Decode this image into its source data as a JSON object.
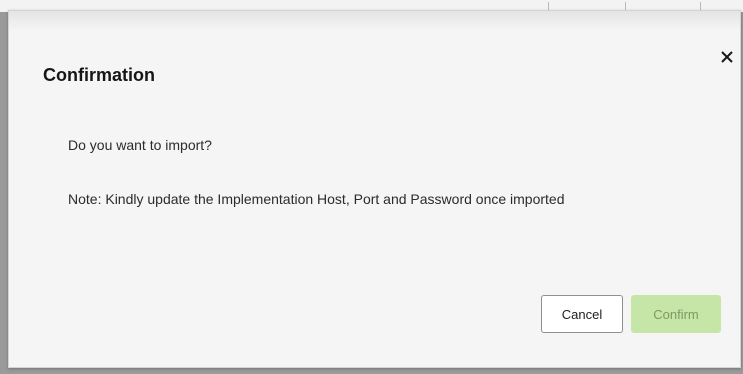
{
  "dialog": {
    "title": "Confirmation",
    "message": "Do you want to import?",
    "note": "Note: Kindly update the Implementation Host, Port and Password once imported",
    "close_icon": "close-icon",
    "buttons": {
      "cancel_label": "Cancel",
      "confirm_label": "Confirm"
    }
  },
  "colors": {
    "confirm_button_bg": "#c6e6a8",
    "confirm_button_text": "#7c9a5e",
    "dialog_bg": "#f5f5f5",
    "overlay": "#9a9a9a"
  }
}
